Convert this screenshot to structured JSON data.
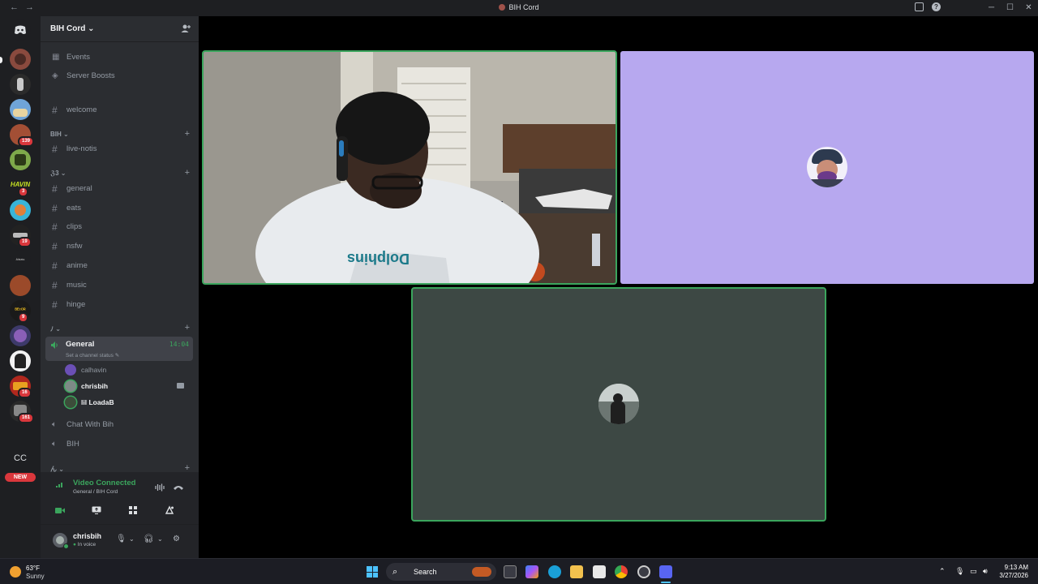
{
  "window": {
    "title": "BIH Cord",
    "nav_back": "←",
    "nav_forward": "→",
    "min": "─",
    "max": "☐",
    "close": "✕",
    "help": "?"
  },
  "server_badges": {
    "s5": "139",
    "s7": "3",
    "s9": "19",
    "s13": "9",
    "s16": "16",
    "s17": "161",
    "cc": "CC",
    "new": "NEW"
  },
  "server": {
    "name": "BIH Cord"
  },
  "sidebar": {
    "events": "Events",
    "boosts": "Server Boosts",
    "welcome": "welcome",
    "cat_bih": "BIH",
    "live_notis": "live-notis",
    "cat_2": "ℨ3",
    "channels": [
      "general",
      "eats",
      "clips",
      "nsfw",
      "anime",
      "music",
      "hinge"
    ],
    "cat_3": "ﾉ",
    "cat_4": "ん"
  },
  "voice": {
    "name": "General",
    "elapsed": "14:04",
    "status_placeholder": "Set a channel status",
    "users": [
      "calhavin",
      "chrisbih",
      "lil LoadaB"
    ],
    "other1": "Chat With Bih",
    "other2": "BIH"
  },
  "voice_panel": {
    "status": "Video Connected",
    "location": "General / BIH Cord"
  },
  "user_panel": {
    "name": "chrisbih",
    "status": "In voice"
  },
  "taskbar": {
    "temp": "63°F",
    "condition": "Sunny",
    "search": "Search",
    "time": "9:13 AM",
    "date": "3/27/2026"
  },
  "colors": {
    "accent_green": "#3ba55d",
    "purple_tile": "#b7a8ef",
    "gray_tile": "#3d4844"
  }
}
